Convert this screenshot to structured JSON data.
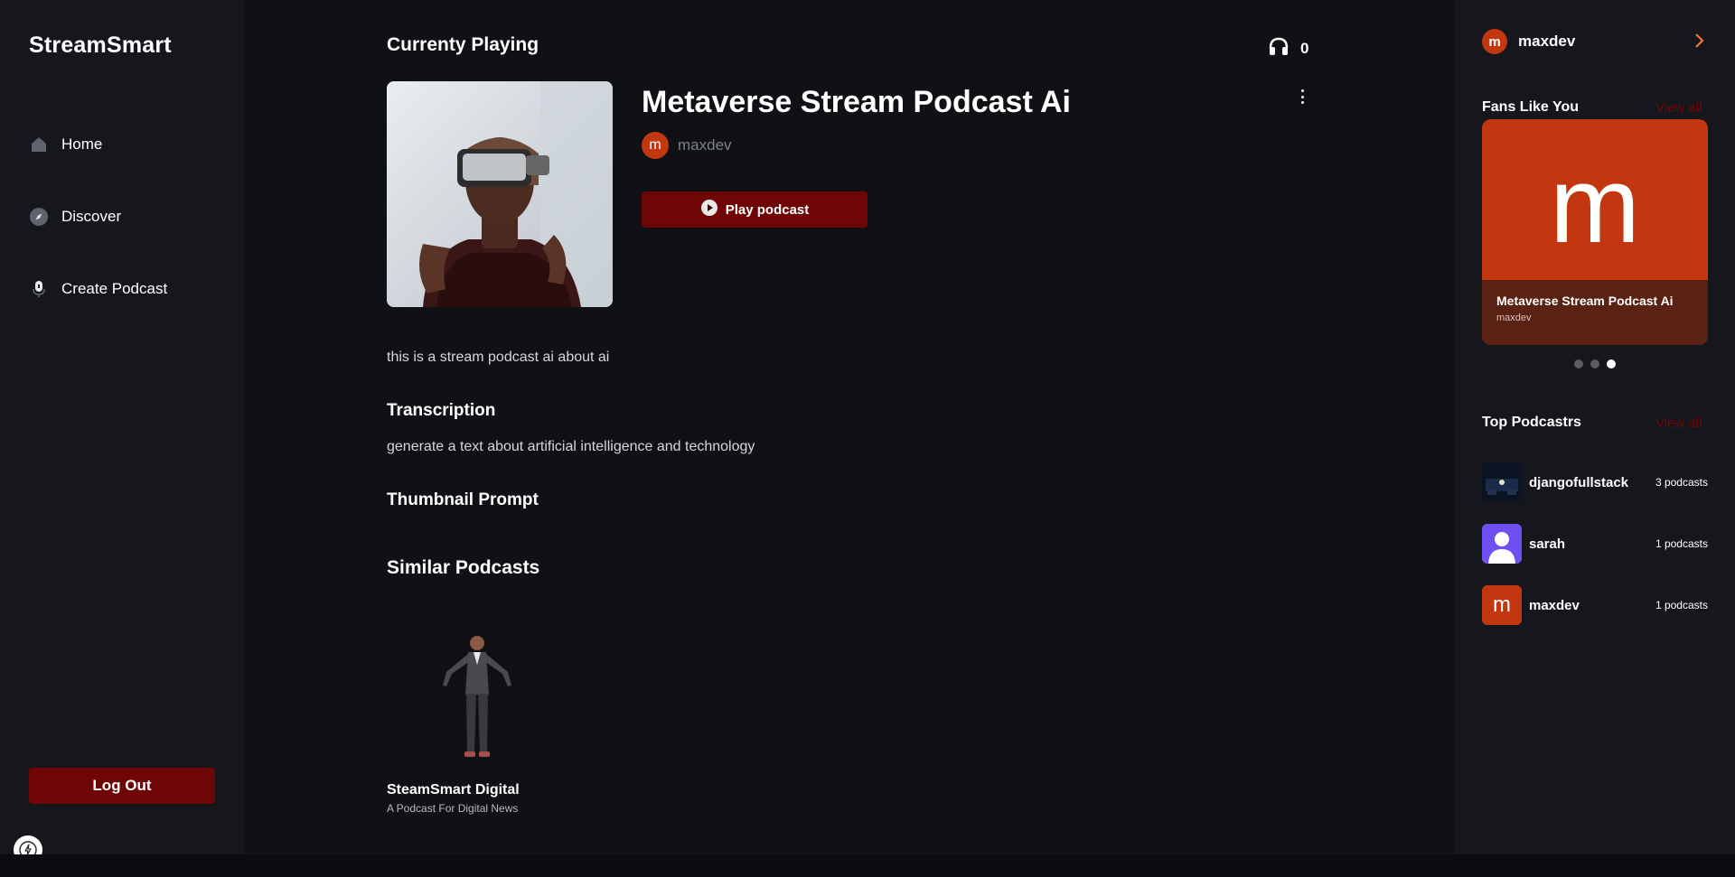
{
  "app": {
    "brand": "StreamSmart"
  },
  "nav": [
    {
      "label": "Home",
      "icon": "home-icon"
    },
    {
      "label": "Discover",
      "icon": "compass-icon"
    },
    {
      "label": "Create Podcast",
      "icon": "microphone-icon"
    }
  ],
  "logout_label": "Log Out",
  "main": {
    "section_title": "Currenty Playing",
    "listeners": "0",
    "podcast": {
      "title": "Metaverse Stream Podcast Ai",
      "author": "maxdev",
      "author_initial": "m",
      "play_label": "Play podcast",
      "description": "this is a stream podcast ai about ai"
    },
    "transcription_title": "Transcription",
    "transcription": "generate a text about artificial intelligence and technology",
    "thumbnail_prompt_title": "Thumbnail Prompt",
    "similar_title": "Similar Podcasts",
    "similar": [
      {
        "name": "SteamSmart Digital",
        "description": "A Podcast For Digital News"
      }
    ]
  },
  "right": {
    "user": {
      "name": "maxdev",
      "initial": "m"
    },
    "fans_title": "Fans Like You",
    "view_all": "View all",
    "fan_card": {
      "letter": "m",
      "title": "Metaverse Stream Podcast Ai",
      "author": "maxdev"
    },
    "carousel_active_index": 2,
    "top_title": "Top Podcastrs",
    "top_podcasters": [
      {
        "name": "djangofullstack",
        "count": "3 podcasts"
      },
      {
        "name": "sarah",
        "count": "1 podcasts"
      },
      {
        "name": "maxdev",
        "count": "1 podcasts",
        "initial": "m"
      }
    ]
  },
  "colors": {
    "background": "#101114",
    "sidebar": "#15171c",
    "primary_button": "#6e0606",
    "avatar_orange": "#c2370f",
    "accent_orange": "#f97535"
  }
}
